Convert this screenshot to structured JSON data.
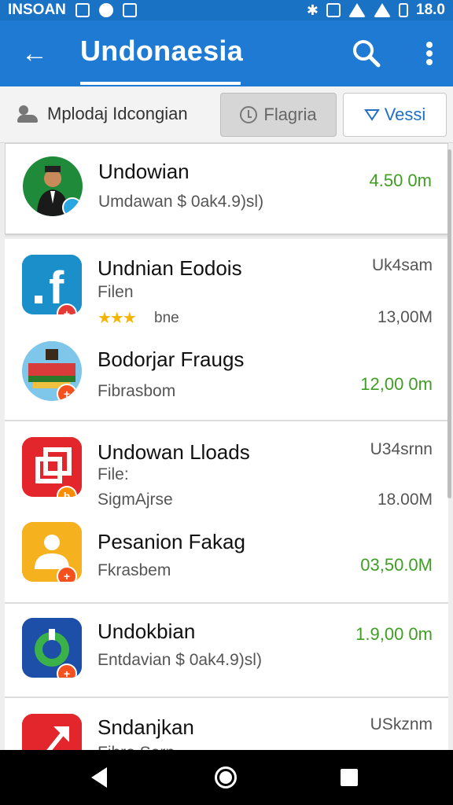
{
  "status_bar": {
    "left_text": "INSOAN",
    "right_text": "18.0",
    "left_icons": [
      "photo-icon",
      "android-icon",
      "sim-icon"
    ],
    "right_icons": [
      "bluetooth-icon",
      "vibrate-icon",
      "wifi-icon",
      "signal-icon",
      "battery-icon"
    ]
  },
  "app_bar": {
    "title": "Undonaesia",
    "back_icon": "arrow-left-icon",
    "search_icon": "search-icon",
    "more_icon": "more-vert-icon",
    "color": "#1f7ad4"
  },
  "filters": {
    "people_label": "Mplodaj Idcongian",
    "flagria_label": "Flagria",
    "vessi_label": "Vessi",
    "vessi_icon": "triangle-down-icon",
    "flagria_icon": "clock-icon",
    "people_icon": "people-icon"
  },
  "items": [
    {
      "name": "Undowian",
      "sub": "Umdawan $ 0ak4.9)sl)",
      "right_green": "4.50 0m"
    },
    {
      "name": "Undnian Eodois",
      "sub": "Filen",
      "right_top": "Uk4sam",
      "right_gray": "13,00M",
      "stars_label": "bne"
    },
    {
      "name": "Bodorjar Fraugs",
      "sub": "Fibrasbom",
      "right_green": "12,00 0m"
    },
    {
      "name": "Undowan Lloads",
      "sub": "File:",
      "sub2": "SigmAjrse",
      "right_top": "U34srnn",
      "right_gray": "18.00M"
    },
    {
      "name": "Pesanion Fakag",
      "sub": "Fkrasbem",
      "right_green": "03,50.0M"
    },
    {
      "name": "Undokbian",
      "sub": "Entdavian $ 0ak4.9)sl)",
      "right_green": "1.9,00 0m"
    },
    {
      "name": "Sndanjkan",
      "sub": "Fibro Sern",
      "right_top": "USkznm"
    }
  ],
  "colors": {
    "accent": "#1f7ad4",
    "size_green": "#3f9e23"
  },
  "nav_bar": {
    "back_icon": "nav-back-icon",
    "home_icon": "nav-home-icon",
    "recent_icon": "nav-recents-icon"
  }
}
